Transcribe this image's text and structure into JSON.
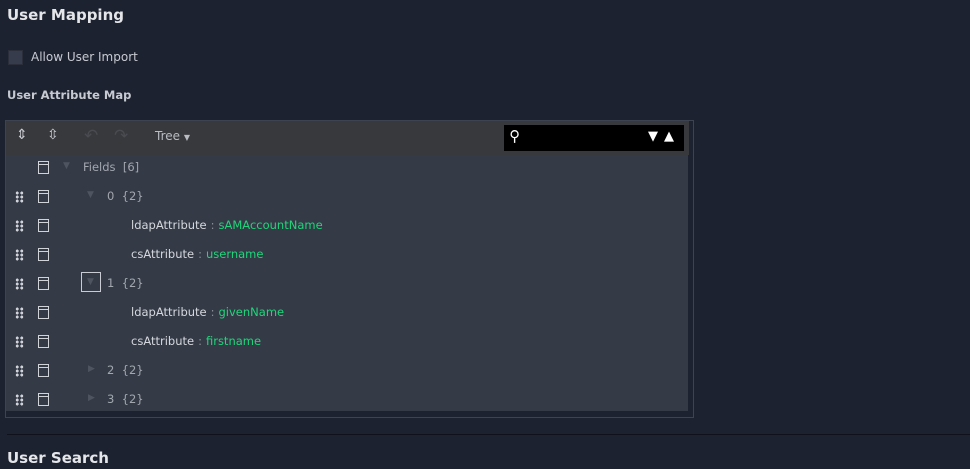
{
  "section_title": "User Mapping",
  "allow_import": {
    "label": "Allow User Import",
    "checked": false
  },
  "map_label": "User Attribute Map",
  "toolbar": {
    "mode": "Tree",
    "search_value": ""
  },
  "tree": {
    "root": {
      "key": "Fields",
      "count": "[6]"
    },
    "rows": [
      {
        "key": "0",
        "count": "{2}"
      },
      {
        "key": "ldapAttribute",
        "value": "sAMAccountName"
      },
      {
        "key": "csAttribute",
        "value": "username"
      },
      {
        "key": "1",
        "count": "{2}"
      },
      {
        "key": "ldapAttribute",
        "value": "givenName"
      },
      {
        "key": "csAttribute",
        "value": "firstname"
      },
      {
        "key": "2",
        "count": "{2}"
      },
      {
        "key": "3",
        "count": "{2}"
      }
    ],
    "colon": ":"
  },
  "next_section": "User Search"
}
